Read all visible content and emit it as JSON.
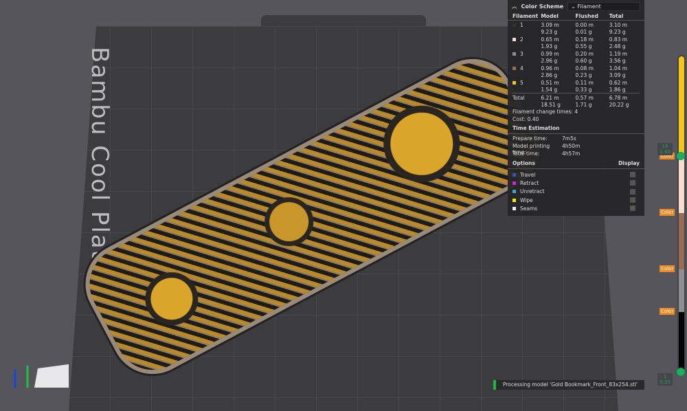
{
  "plate_label": "Bambu Cool Plate",
  "panel": {
    "title": "Color Scheme",
    "scheme": "Filament",
    "headers": [
      "Filament",
      "Model",
      "Flushed",
      "Total"
    ],
    "rows": [
      {
        "id": "1",
        "color": "#333333",
        "model_m": "3.09 m",
        "model_g": "9.23 g",
        "flushed_m": "0.00 m",
        "flushed_g": "0.01 g",
        "total_m": "3.10 m",
        "total_g": "9.23 g"
      },
      {
        "id": "2",
        "color": "#f6dccc",
        "model_m": "0.65 m",
        "model_g": "1.93 g",
        "flushed_m": "0.18 m",
        "flushed_g": "0.55 g",
        "total_m": "0.83 m",
        "total_g": "2.48 g"
      },
      {
        "id": "3",
        "color": "#8e8e8e",
        "model_m": "0.99 m",
        "model_g": "2.96 g",
        "flushed_m": "0.20 m",
        "flushed_g": "0.60 g",
        "total_m": "1.19 m",
        "total_g": "3.56 g"
      },
      {
        "id": "4",
        "color": "#9a6a55",
        "model_m": "0.96 m",
        "model_g": "2.86 g",
        "flushed_m": "0.08 m",
        "flushed_g": "0.23 g",
        "total_m": "1.04 m",
        "total_g": "3.09 g"
      },
      {
        "id": "5",
        "color": "#f5c518",
        "model_m": "0.51 m",
        "model_g": "1.54 g",
        "flushed_m": "0.11 m",
        "flushed_g": "0.33 g",
        "total_m": "0.62 m",
        "total_g": "1.86 g"
      }
    ],
    "total": {
      "label": "Total",
      "model_m": "6.21 m",
      "model_g": "18.51 g",
      "flushed_m": "0.57 m",
      "flushed_g": "1.71 g",
      "total_m": "6.78 m",
      "total_g": "20.22 g"
    },
    "change_times": "Filament change times:  4",
    "cost": "Cost:  0.40",
    "time_title": "Time Estimation",
    "times": [
      [
        "Prepare time:",
        "7m5s"
      ],
      [
        "Model printing time:",
        "4h50m"
      ],
      [
        "Total time:",
        "4h57m"
      ]
    ],
    "options_title": "Options",
    "display_title": "Display",
    "options": [
      {
        "label": "Travel",
        "color": "#3b52b0",
        "checked": false
      },
      {
        "label": "Retract",
        "color": "#c82ad0",
        "checked": false
      },
      {
        "label": "Unretract",
        "color": "#35a8d0",
        "checked": false
      },
      {
        "label": "Wipe",
        "color": "#f0f000",
        "checked": false
      },
      {
        "label": "Seams",
        "color": "#eeeeee",
        "checked": true
      }
    ]
  },
  "slider": {
    "top_layer": "16",
    "top_height": "1.40",
    "bottom_layer": "1",
    "bottom_height": "0.20",
    "color_label": "Color"
  },
  "status": "Processing model 'Gold Bookmark_Front_83x254.stl'"
}
